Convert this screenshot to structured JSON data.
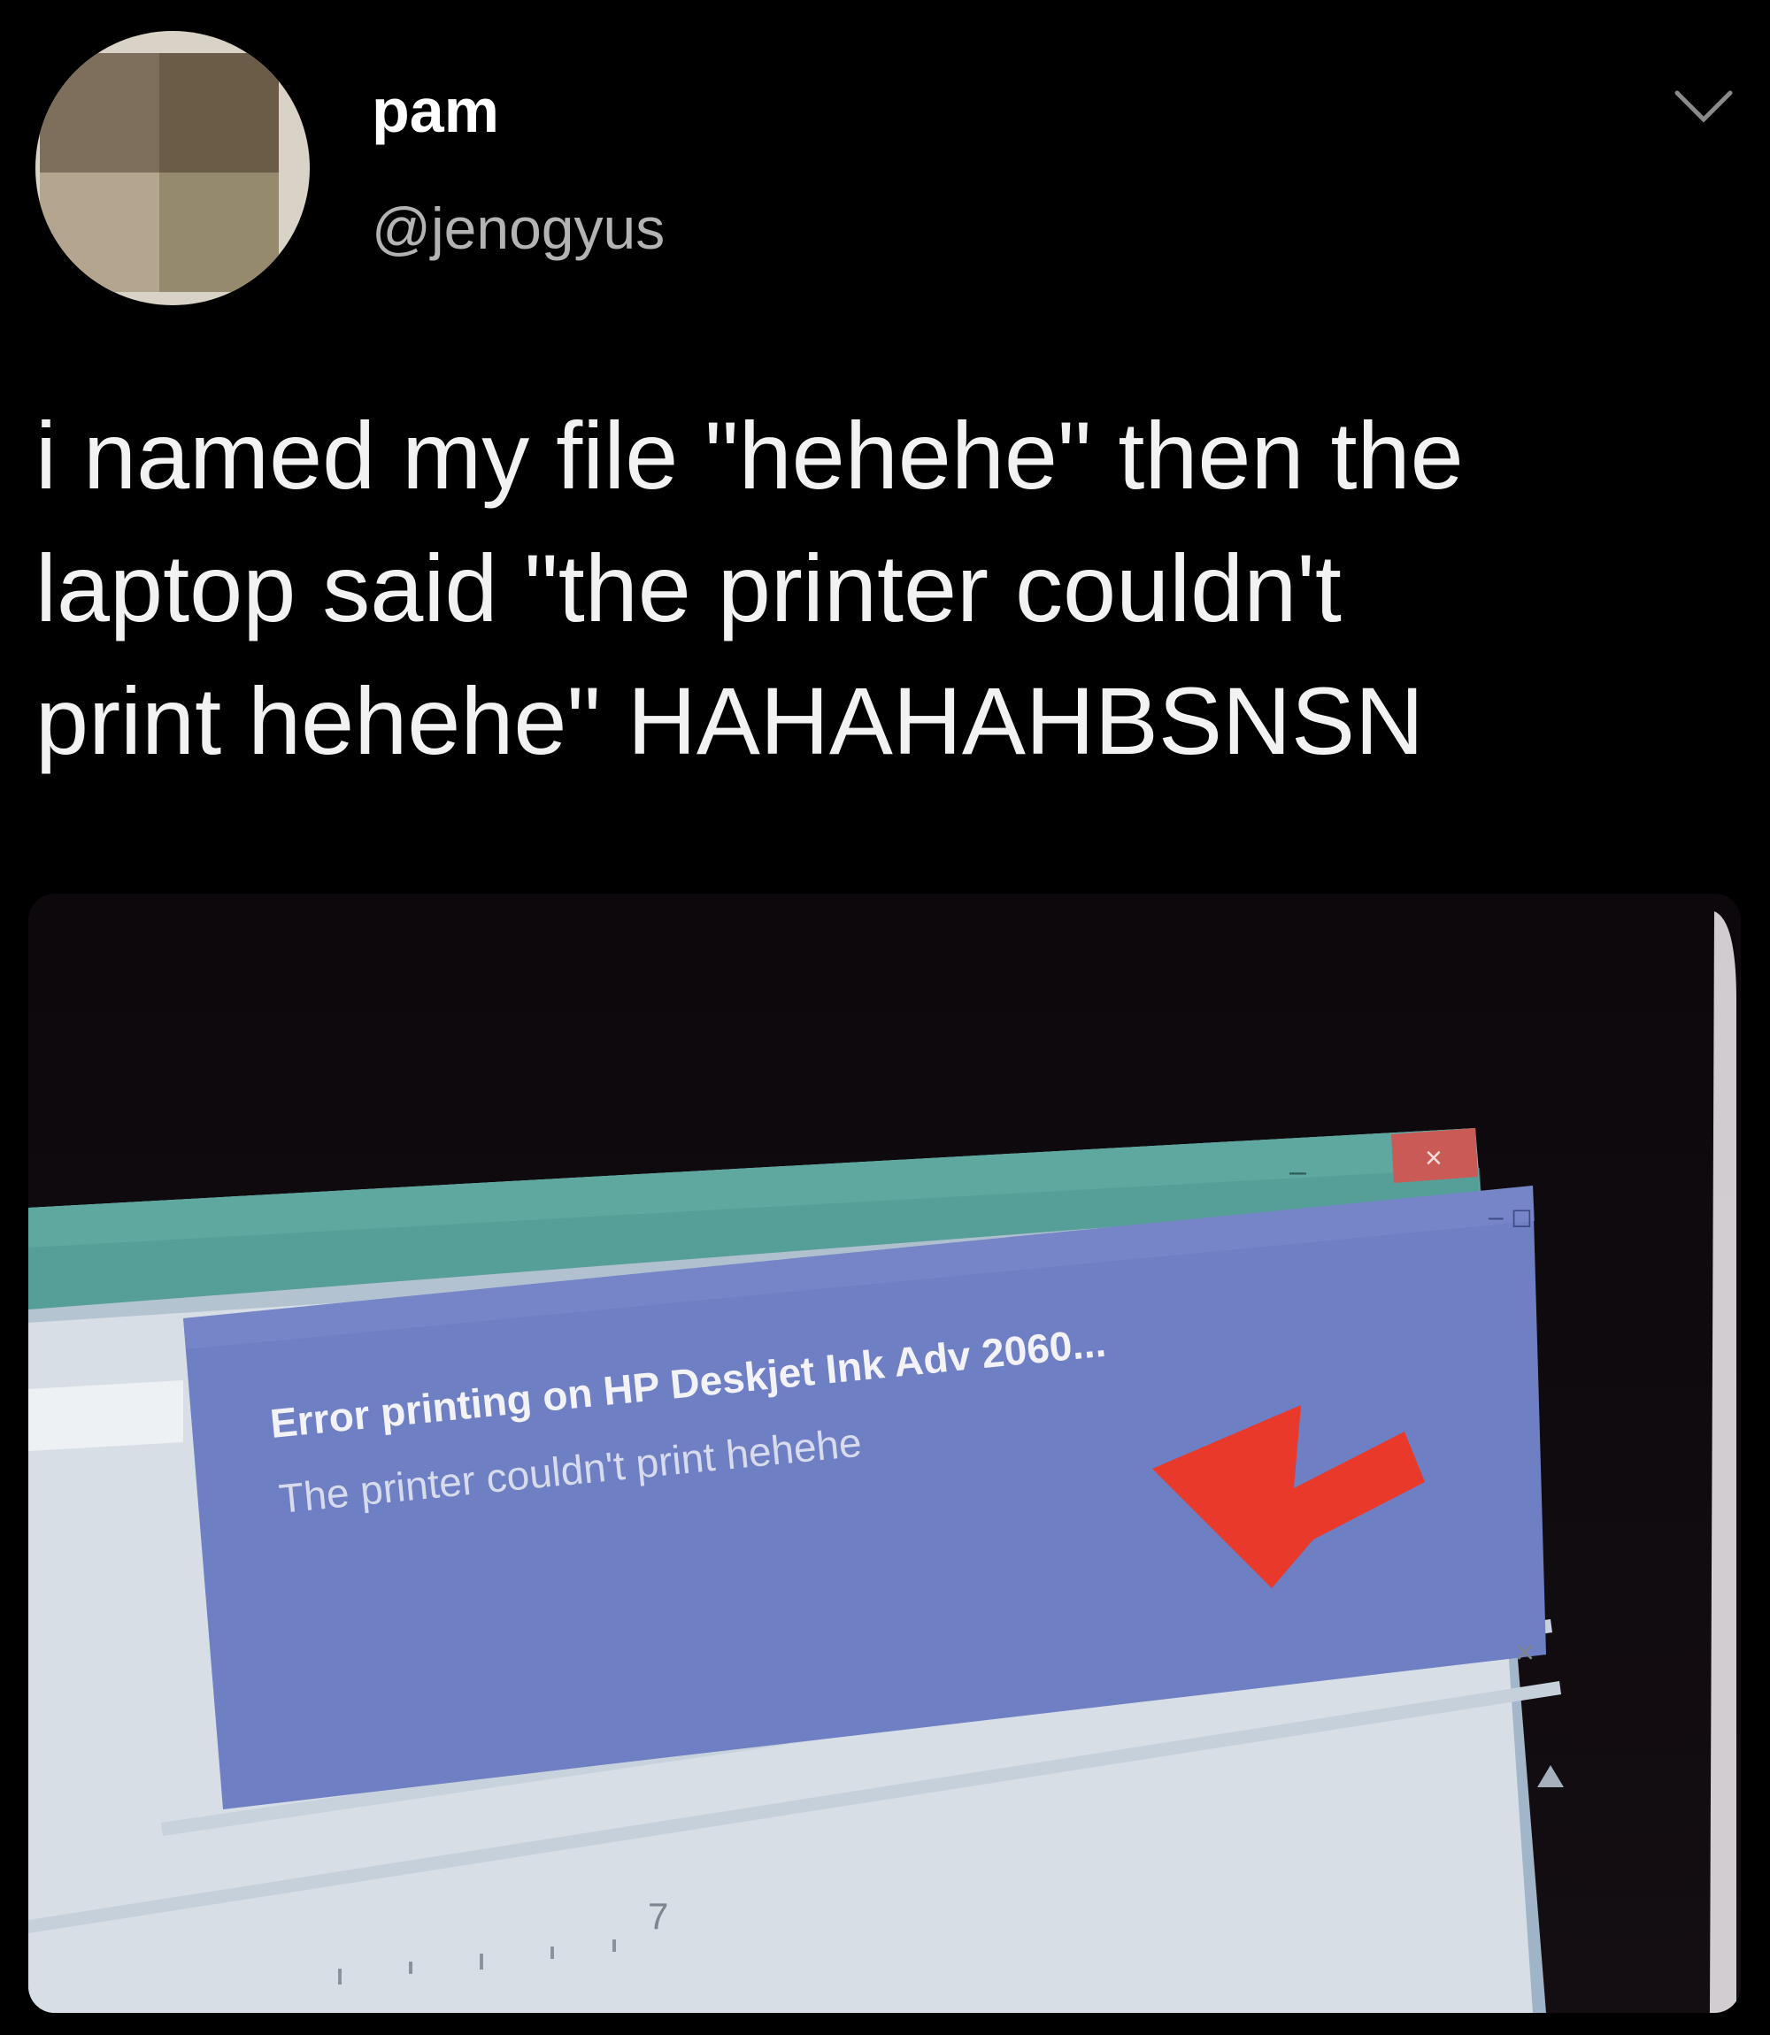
{
  "tweet": {
    "display_name": "pam",
    "handle": "@jenogyus",
    "text": "i named my file \"hehehe\" then the\nlaptop said \"the printer couldn't\nprint hehehe\" HAHAHAHBSNSN",
    "menu_icon": "chevron-down-icon"
  },
  "photo": {
    "notification": {
      "title": "Error printing on HP Deskjet Ink Adv 2060...",
      "message": "The printer couldn't print hehehe",
      "close_icon": "close-icon"
    },
    "window_controls": {
      "minimize": "–",
      "close": "×"
    },
    "ruler_number": "7",
    "arrow_color": "#e8392a",
    "toast_color": "#6f7fc4"
  }
}
